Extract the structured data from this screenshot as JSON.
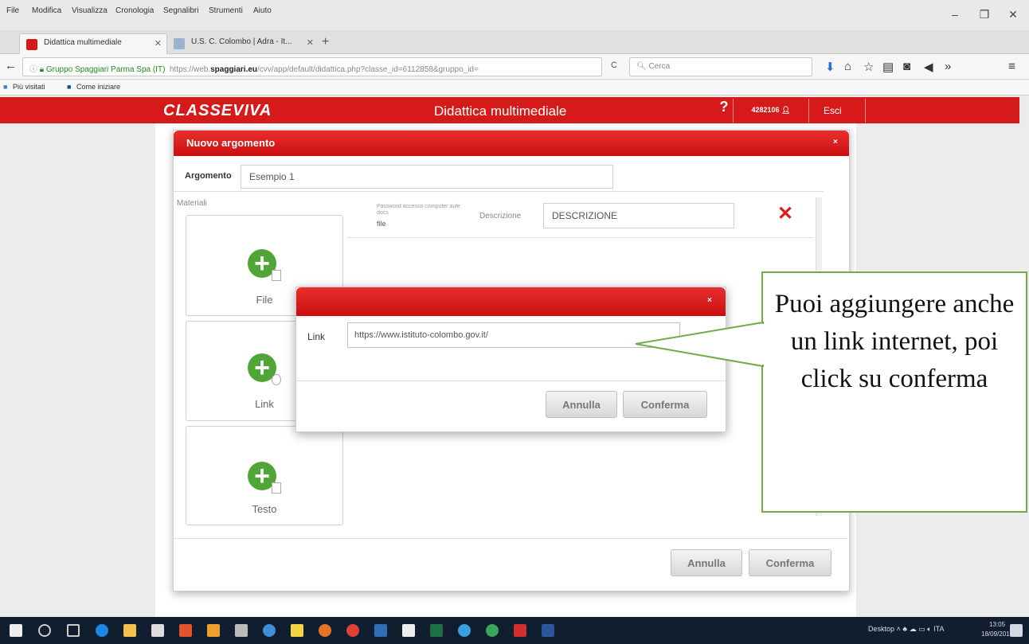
{
  "browser": {
    "menu": [
      "File",
      "Modifica",
      "Visualizza",
      "Cronologia",
      "Segnalibri",
      "Strumenti",
      "Aiuto"
    ],
    "window_controls": {
      "minimize": "–",
      "restore": "❐",
      "close": "✕"
    },
    "tabs": [
      {
        "label": "Didattica multimediale",
        "close": "✕"
      },
      {
        "label": "U.S. C. Colombo | Adra - It...",
        "close": "✕"
      }
    ],
    "new_tab": "+",
    "back": "←",
    "site_identity": "Gruppo Spaggiari Parma Spa (IT)",
    "url_prefix": "https://web.",
    "url_host": "spaggiari.eu",
    "url_path": "/cvv/app/default/didattica.php?classe_id=6112858&gruppo_id=",
    "reload": "C",
    "search_placeholder": "Cerca",
    "bookmarks": [
      "Più visitati",
      "Come iniziare"
    ]
  },
  "page": {
    "logo": "CLASSEVIVA",
    "title": "Didattica multimediale",
    "help": "?",
    "user_code": "4282106",
    "exit": "Esci"
  },
  "dialog_main": {
    "title": "Nuovo argomento",
    "close": "×",
    "topic_label": "Argomento",
    "topic_value": "Esempio 1",
    "materials_label": "Materiali",
    "cards": [
      {
        "label": "File"
      },
      {
        "label": "Link"
      },
      {
        "label": "Testo"
      }
    ],
    "material_row": {
      "hint": "Password accesso computer aule docs",
      "type": "file",
      "description_label": "Descrizione",
      "description_value": "DESCRIZIONE",
      "delete": "✕"
    },
    "cancel": "Annulla",
    "confirm": "Conferma"
  },
  "dialog_link": {
    "close": "×",
    "link_label": "Link",
    "link_value": "https://www.istituto-colombo.gov.it/",
    "cancel": "Annulla",
    "confirm": "Conferma"
  },
  "callout": {
    "text": "Puoi aggiungere anche un link internet, poi click su conferma"
  },
  "taskbar": {
    "desktop": "Desktop",
    "lang": "ITA",
    "time": "13:05",
    "date": "18/09/2017"
  },
  "colors": {
    "brand_red": "#d61a1a",
    "plus_green": "#4fa637",
    "callout_border": "#70ad47",
    "taskbar": "#101e2f"
  }
}
